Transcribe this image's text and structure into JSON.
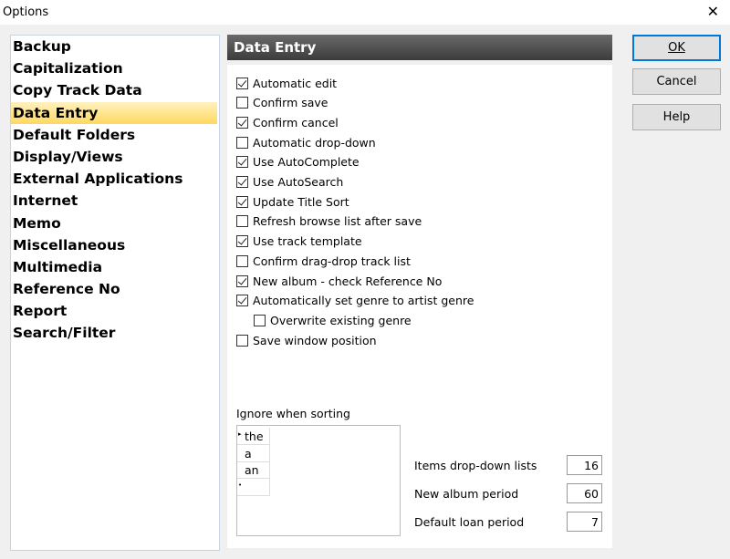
{
  "window": {
    "title": "Options",
    "close_icon": "close-icon"
  },
  "categories": [
    "Backup",
    "Capitalization",
    "Copy Track Data",
    "Data Entry",
    "Default Folders",
    "Display/Views",
    "External Applications",
    "Internet",
    "Memo",
    "Miscellaneous",
    "Multimedia",
    "Reference No",
    "Report",
    "Search/Filter"
  ],
  "selected_category": "Data Entry",
  "panel": {
    "title": "Data Entry",
    "options": [
      {
        "label": "Automatic edit",
        "checked": true
      },
      {
        "label": "Confirm save",
        "checked": false
      },
      {
        "label": "Confirm cancel",
        "checked": true
      },
      {
        "label": "Automatic drop-down",
        "checked": false
      },
      {
        "label": "Use AutoComplete",
        "checked": true
      },
      {
        "label": "Use AutoSearch",
        "checked": true
      },
      {
        "label": "Update Title Sort",
        "checked": true
      },
      {
        "label": "Refresh browse list after save",
        "checked": false
      },
      {
        "label": "Use track template",
        "checked": true
      },
      {
        "label": "Confirm drag-drop track list",
        "checked": false
      },
      {
        "label": "New album - check Reference No",
        "checked": true
      },
      {
        "label": "Automatically set genre to artist genre",
        "checked": true
      },
      {
        "label": "Overwrite existing genre",
        "checked": false,
        "indent": true
      },
      {
        "label": "Save window position",
        "checked": false
      }
    ],
    "ignore_label": "Ignore when sorting",
    "ignore_words": [
      "the",
      "a",
      "an",
      ""
    ],
    "fields": [
      {
        "label": "Items drop-down lists",
        "value": "16"
      },
      {
        "label": "New album period",
        "value": "60"
      },
      {
        "label": "Default loan period",
        "value": "7"
      }
    ]
  },
  "buttons": {
    "ok": "OK",
    "cancel": "Cancel",
    "help": "Help"
  }
}
